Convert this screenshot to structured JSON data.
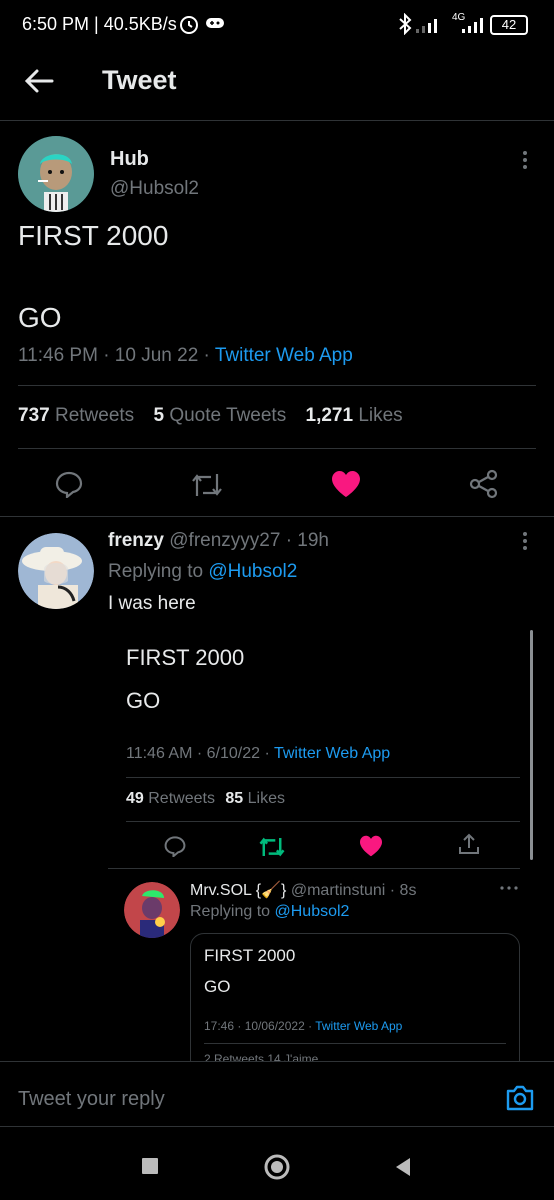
{
  "status_bar": {
    "time_speed": "6:50 PM | 40.5KB/s",
    "network": "4G",
    "battery": "42"
  },
  "header": {
    "title": "Tweet"
  },
  "main_tweet": {
    "name": "Hub",
    "handle": "@Hubsol2",
    "line1": "FIRST 2000",
    "line2": "GO",
    "time": "11:46 PM · 10 Jun 22 · ",
    "source": "Twitter Web App",
    "retweets_count": "737",
    "retweets_label": "Retweets",
    "quotes_count": "5",
    "quotes_label": "Quote Tweets",
    "likes_count": "1,271",
    "likes_label": "Likes"
  },
  "reply": {
    "name": "frenzy",
    "handle_time": "@frenzyyy27 · 19h",
    "replying_prefix": "Replying to ",
    "replying_to": "@Hubsol2",
    "text": "I was here"
  },
  "embed1": {
    "line1": "FIRST 2000",
    "line2": "GO",
    "time": "11:46 AM · 6/10/22 · ",
    "source": "Twitter Web App",
    "retweets_count": "49",
    "retweets_label": "Retweets",
    "likes_count": "85",
    "likes_label": "Likes"
  },
  "nested": {
    "name": "Mrv.SOL {🧹}",
    "handle_time": "@martinstuni · 8s",
    "replying_prefix": "Replying to ",
    "replying_to": "@Hubsol2",
    "line1": "FIRST 2000",
    "line2": "GO",
    "time": "17:46 · 10/06/2022 · ",
    "source": "Twitter Web App",
    "stats_partial": "2 Retweets  14 J'aime"
  },
  "reply_bar": {
    "placeholder": "Tweet your reply"
  },
  "colors": {
    "accent": "#1d9bf0",
    "like": "#f91880",
    "retweet": "#00ba7c",
    "muted": "#71767b"
  }
}
